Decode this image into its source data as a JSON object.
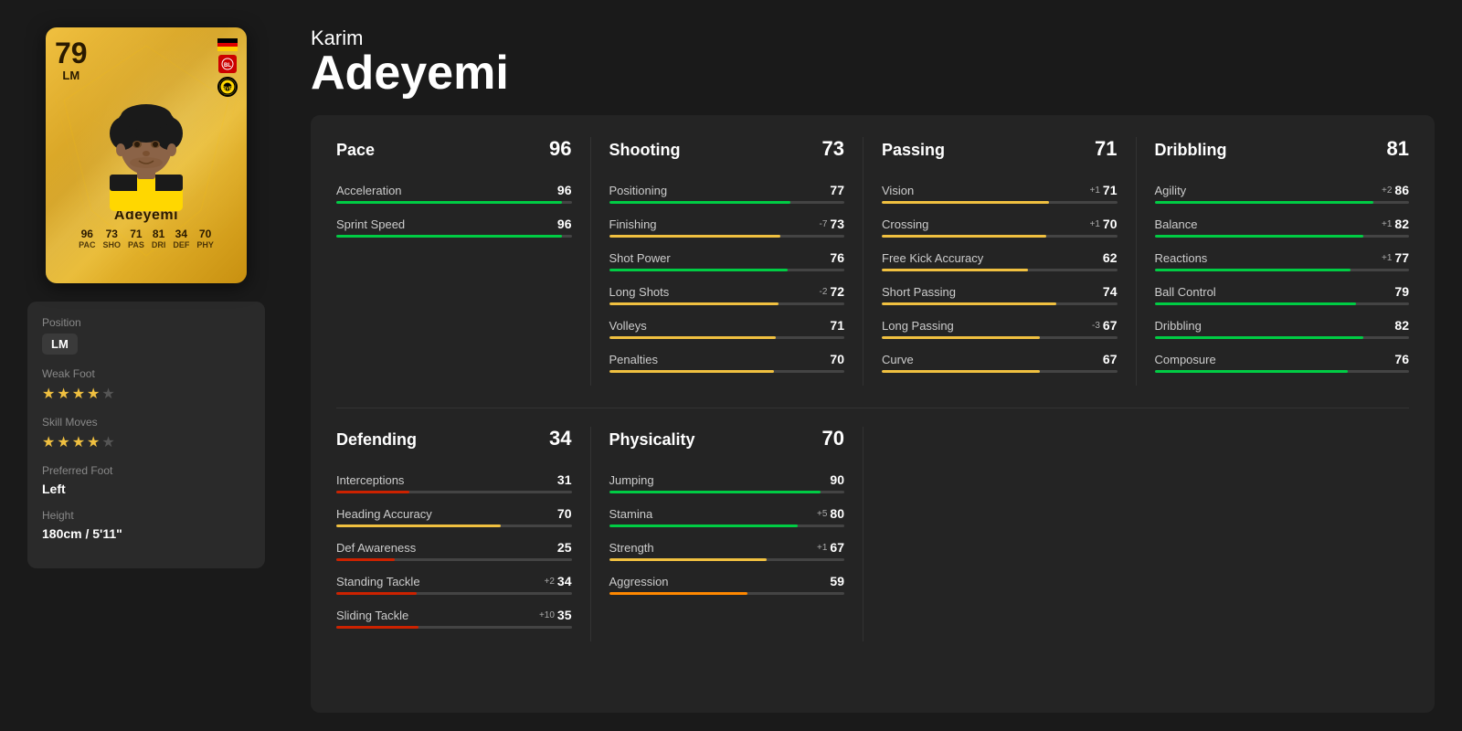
{
  "player": {
    "first_name": "Karim",
    "last_name": "Adeyemi",
    "card_rating": "79",
    "card_position": "LM",
    "card_name": "Adeyemi"
  },
  "card_stats": {
    "pac": "96",
    "sho": "73",
    "pas": "71",
    "dri": "81",
    "def": "34",
    "phy": "70"
  },
  "player_info": {
    "position_label": "Position",
    "position_value": "LM",
    "weak_foot_label": "Weak Foot",
    "weak_foot_stars": 4,
    "skill_moves_label": "Skill Moves",
    "skill_moves_stars": 4,
    "preferred_foot_label": "Preferred Foot",
    "preferred_foot_value": "Left",
    "height_label": "Height",
    "height_value": "180cm / 5'11\""
  },
  "categories": {
    "pace": {
      "name": "Pace",
      "value": 96,
      "stats": [
        {
          "name": "Acceleration",
          "value": 96,
          "badge": "",
          "color": "green"
        },
        {
          "name": "Sprint Speed",
          "value": 96,
          "badge": "",
          "color": "green"
        }
      ]
    },
    "shooting": {
      "name": "Shooting",
      "value": 73,
      "stats": [
        {
          "name": "Positioning",
          "value": 77,
          "badge": "",
          "color": "green"
        },
        {
          "name": "Finishing",
          "value": 73,
          "badge": "-7",
          "color": "green"
        },
        {
          "name": "Shot Power",
          "value": 76,
          "badge": "",
          "color": "green"
        },
        {
          "name": "Long Shots",
          "value": 72,
          "badge": "-2",
          "color": "green"
        },
        {
          "name": "Volleys",
          "value": 71,
          "badge": "",
          "color": "green"
        },
        {
          "name": "Penalties",
          "value": 70,
          "badge": "",
          "color": "green"
        }
      ]
    },
    "passing": {
      "name": "Passing",
      "value": 71,
      "stats": [
        {
          "name": "Vision",
          "value": 71,
          "badge": "+1",
          "color": "green"
        },
        {
          "name": "Crossing",
          "value": 70,
          "badge": "+1",
          "color": "green"
        },
        {
          "name": "Free Kick Accuracy",
          "value": 62,
          "badge": "",
          "color": "yellow"
        },
        {
          "name": "Short Passing",
          "value": 74,
          "badge": "",
          "color": "green"
        },
        {
          "name": "Long Passing",
          "value": 67,
          "badge": "-3",
          "color": "yellow"
        },
        {
          "name": "Curve",
          "value": 67,
          "badge": "",
          "color": "yellow"
        }
      ]
    },
    "dribbling": {
      "name": "Dribbling",
      "value": 81,
      "stats": [
        {
          "name": "Agility",
          "value": 86,
          "badge": "+2",
          "color": "green"
        },
        {
          "name": "Balance",
          "value": 82,
          "badge": "+1",
          "color": "green"
        },
        {
          "name": "Reactions",
          "value": 77,
          "badge": "+1",
          "color": "green"
        },
        {
          "name": "Ball Control",
          "value": 79,
          "badge": "",
          "color": "green"
        },
        {
          "name": "Dribbling",
          "value": 82,
          "badge": "",
          "color": "green"
        },
        {
          "name": "Composure",
          "value": 76,
          "badge": "",
          "color": "green"
        }
      ]
    },
    "defending": {
      "name": "Defending",
      "value": 34,
      "stats": [
        {
          "name": "Interceptions",
          "value": 31,
          "badge": "",
          "color": "red"
        },
        {
          "name": "Heading Accuracy",
          "value": 70,
          "badge": "",
          "color": "yellow"
        },
        {
          "name": "Def Awareness",
          "value": 25,
          "badge": "",
          "color": "red"
        },
        {
          "name": "Standing Tackle",
          "value": 34,
          "badge": "+2",
          "color": "red"
        },
        {
          "name": "Sliding Tackle",
          "value": 35,
          "badge": "+10",
          "color": "red"
        }
      ]
    },
    "physicality": {
      "name": "Physicality",
      "value": 70,
      "stats": [
        {
          "name": "Jumping",
          "value": 90,
          "badge": "",
          "color": "green"
        },
        {
          "name": "Stamina",
          "value": 80,
          "badge": "+5",
          "color": "green"
        },
        {
          "name": "Strength",
          "value": 67,
          "badge": "+1",
          "color": "yellow"
        },
        {
          "name": "Aggression",
          "value": 59,
          "badge": "",
          "color": "yellow"
        }
      ]
    }
  },
  "labels": {
    "pac": "PAC",
    "sho": "SHO",
    "pas": "PAS",
    "dri": "DRI",
    "def": "DEF",
    "phy": "PHY"
  }
}
